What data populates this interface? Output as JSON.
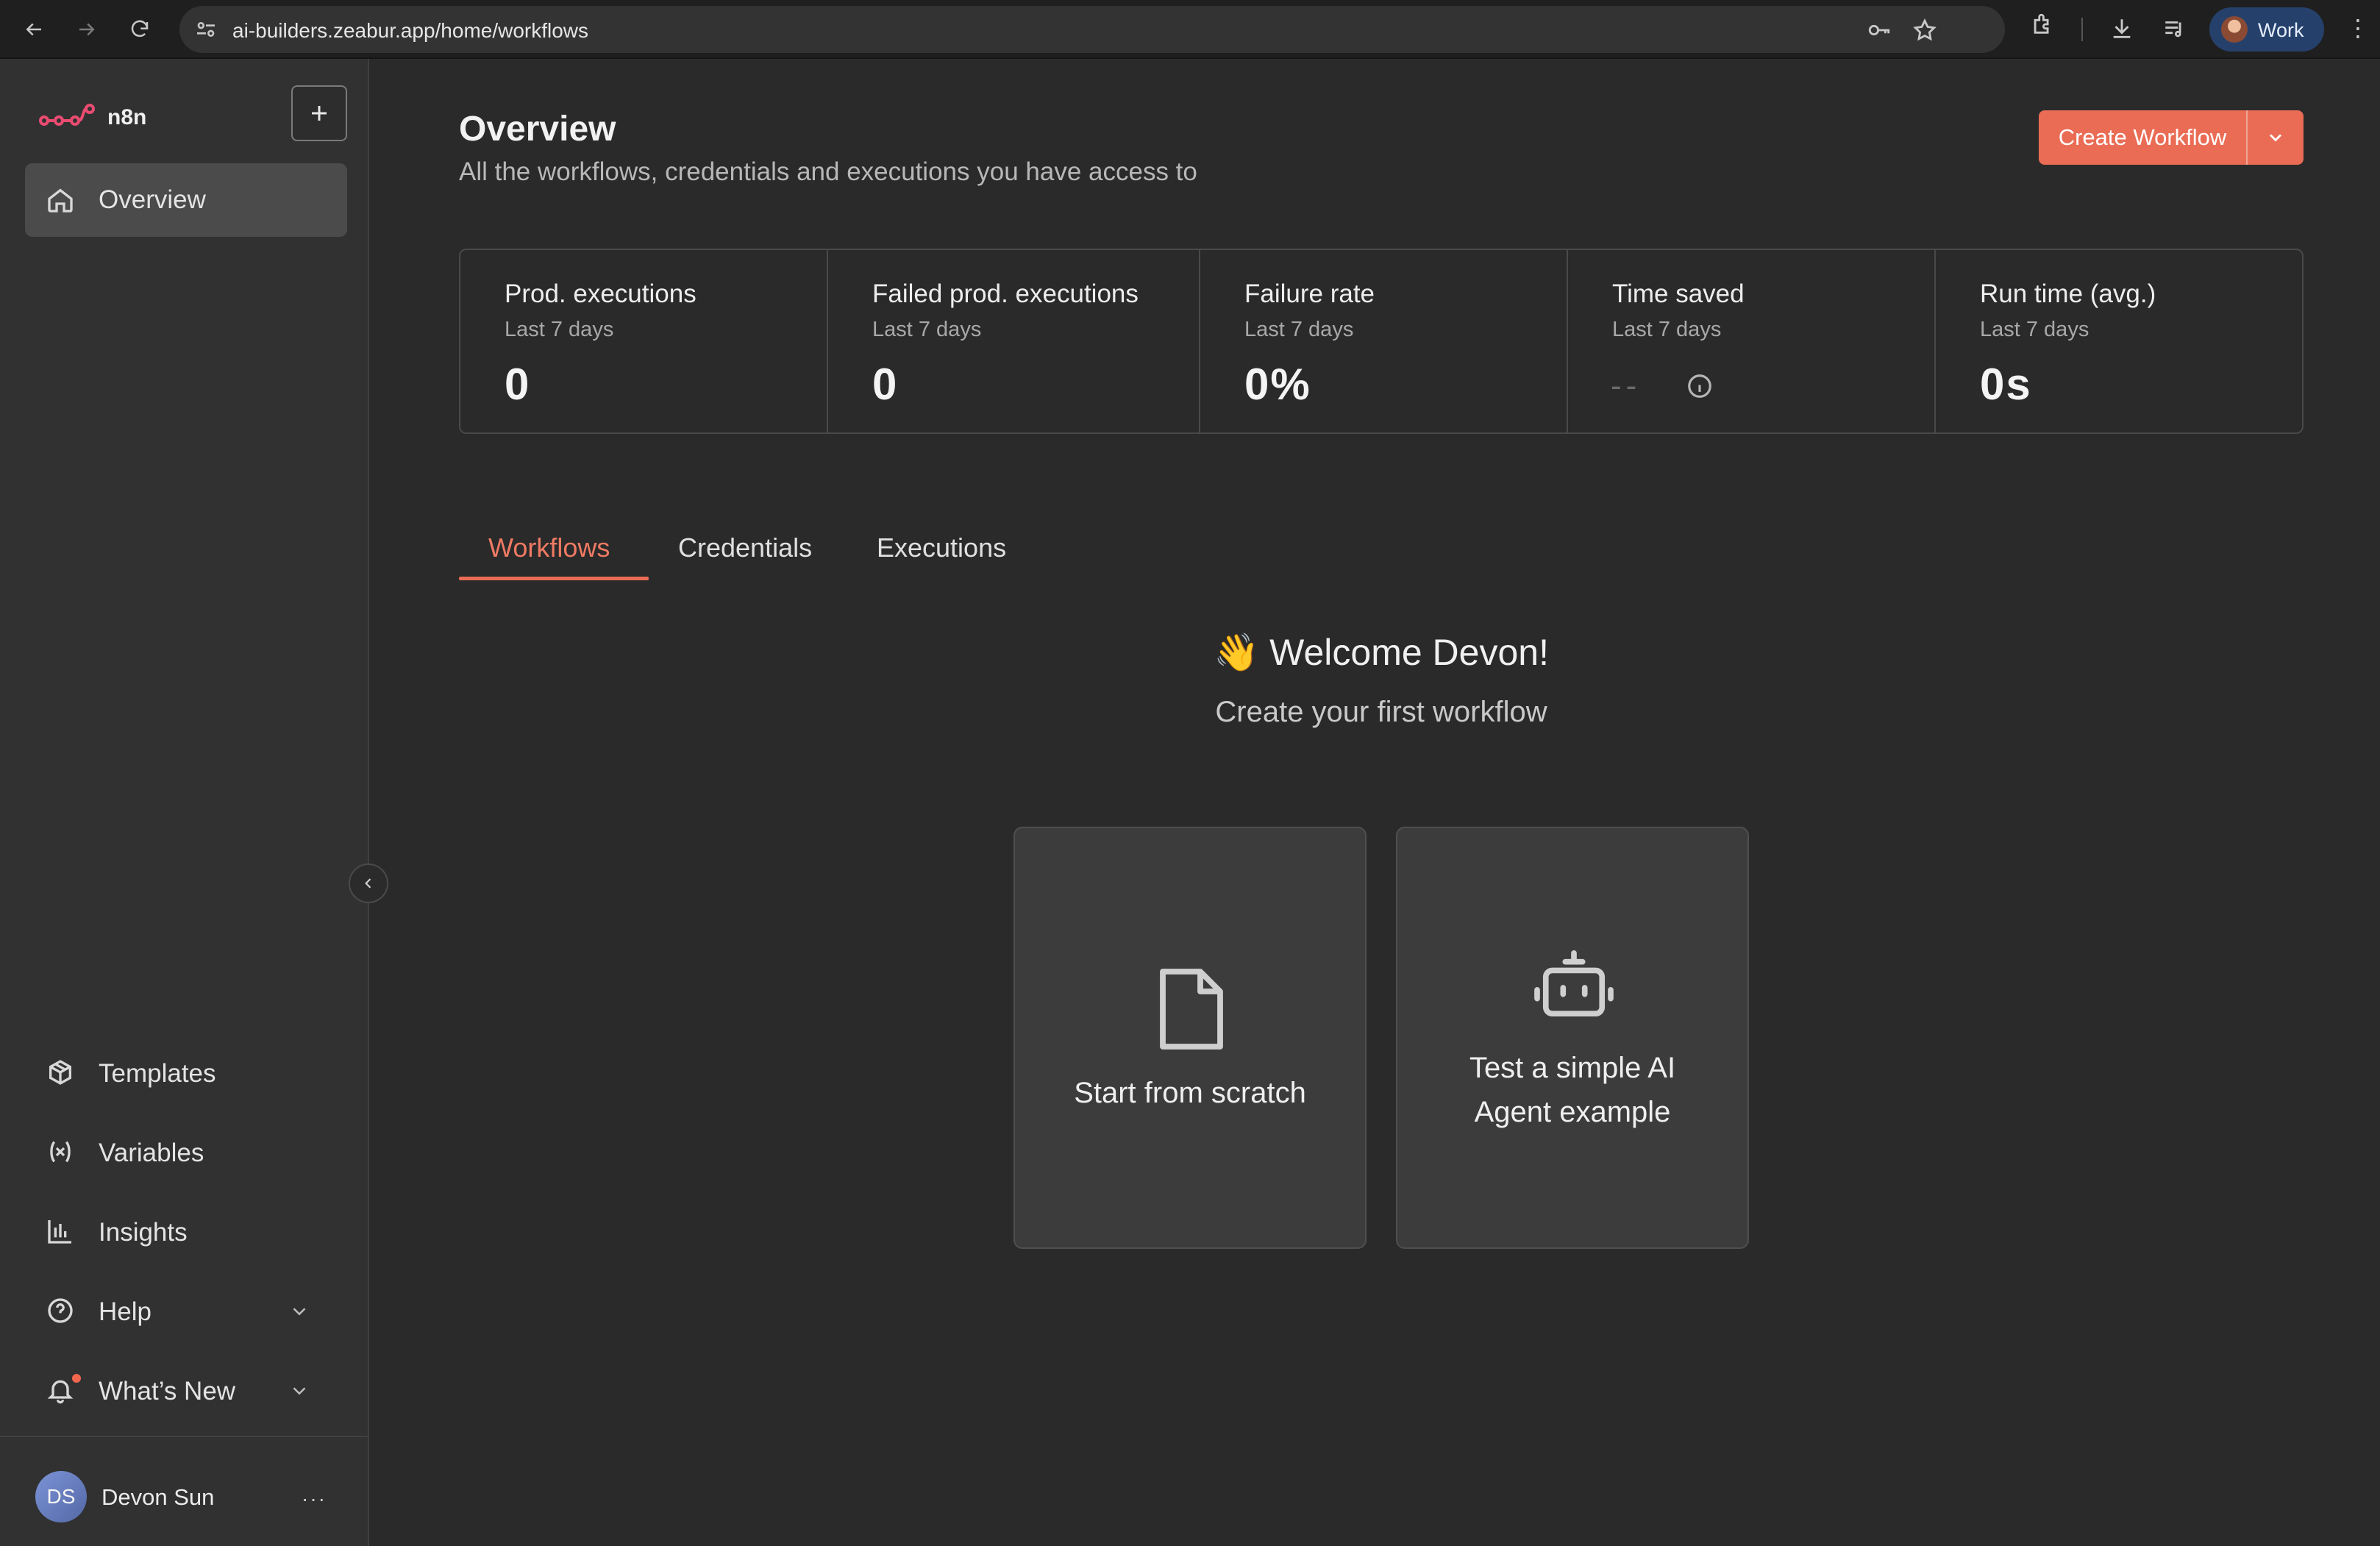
{
  "browser": {
    "url": "ai-builders.zeabur.app/home/workflows",
    "profile_label": "Work"
  },
  "sidebar": {
    "brand": "n8n",
    "nav": [
      {
        "label": "Overview",
        "icon": "home-icon",
        "active": true
      }
    ],
    "bottom_items": [
      {
        "label": "Templates",
        "icon": "templates-icon"
      },
      {
        "label": "Variables",
        "icon": "variables-icon"
      },
      {
        "label": "Insights",
        "icon": "insights-icon"
      },
      {
        "label": "Help",
        "icon": "help-icon"
      },
      {
        "label": "What’s New",
        "icon": "bell-icon"
      }
    ],
    "user": {
      "initials": "DS",
      "name": "Devon Sun"
    }
  },
  "header": {
    "title": "Overview",
    "subtitle": "All the workflows, credentials and executions you have access to",
    "create_button": "Create Workflow"
  },
  "stats": [
    {
      "title": "Prod. executions",
      "period": "Last 7 days",
      "value": "0"
    },
    {
      "title": "Failed prod. executions",
      "period": "Last 7 days",
      "value": "0"
    },
    {
      "title": "Failure rate",
      "period": "Last 7 days",
      "value": "0%"
    },
    {
      "title": "Time saved",
      "period": "Last 7 days",
      "value": "--"
    },
    {
      "title": "Run time (avg.)",
      "period": "Last 7 days",
      "value": "0s"
    }
  ],
  "tabs": [
    {
      "label": "Workflows",
      "active": true
    },
    {
      "label": "Credentials",
      "active": false
    },
    {
      "label": "Executions",
      "active": false
    }
  ],
  "welcome": {
    "title": "👋 Welcome Devon!",
    "subtitle": "Create your first workflow"
  },
  "cards": [
    {
      "label": "Start from scratch",
      "icon": "file-icon"
    },
    {
      "label_line1": "Test a simple AI",
      "label_line2": "Agent example",
      "icon": "robot-icon"
    }
  ],
  "colors": {
    "accent": "#ea6c55",
    "background": "#2a2a2a",
    "sidebar": "#313131"
  }
}
